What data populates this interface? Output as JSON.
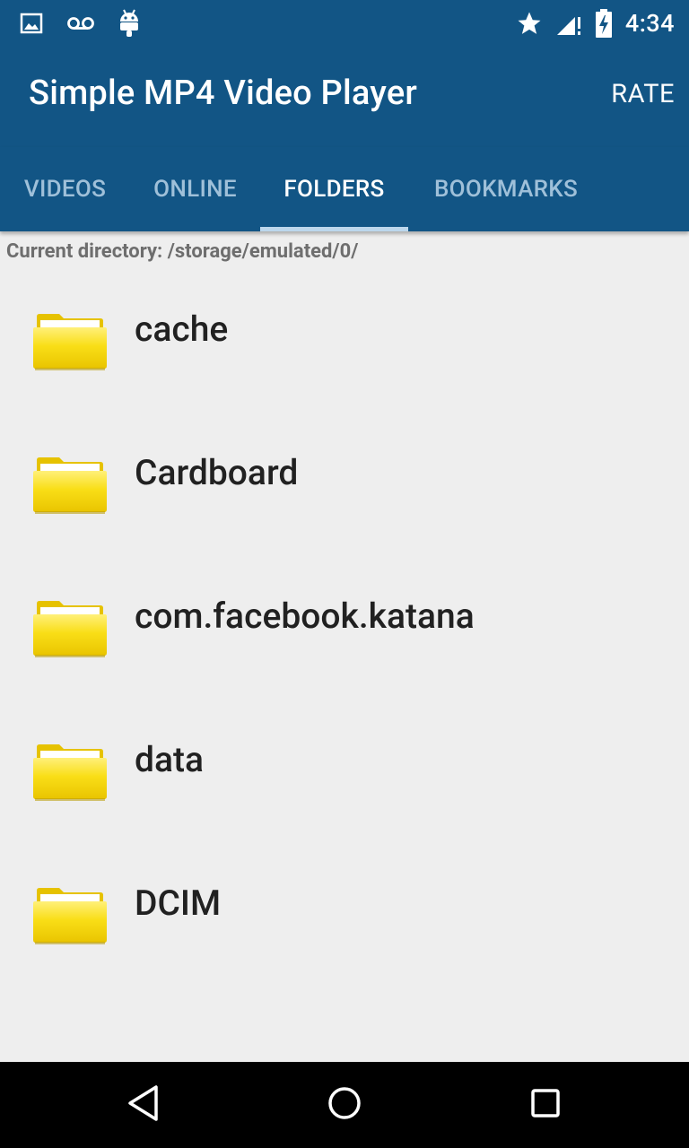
{
  "status_bar": {
    "left_icons": [
      "image-icon",
      "voicemail-icon",
      "android-icon"
    ],
    "right_icons": [
      "star-icon",
      "signal-icon",
      "battery-icon"
    ],
    "time": "4:34"
  },
  "app_bar": {
    "title": "Simple MP4 Video Player",
    "rate_label": "RATE"
  },
  "tabs": [
    {
      "label": "VIDEOS",
      "active": false
    },
    {
      "label": "ONLINE",
      "active": false
    },
    {
      "label": "FOLDERS",
      "active": true
    },
    {
      "label": "BOOKMARKS",
      "active": false
    }
  ],
  "current_directory": "Current directory: /storage/emulated/0/",
  "folders": [
    {
      "name": "cache",
      "icon": "folder-icon"
    },
    {
      "name": "Cardboard",
      "icon": "folder-icon"
    },
    {
      "name": "com.facebook.katana",
      "icon": "folder-icon"
    },
    {
      "name": "data",
      "icon": "folder-icon"
    },
    {
      "name": "DCIM",
      "icon": "folder-icon"
    }
  ],
  "nav_bar": [
    "back-icon",
    "home-icon",
    "recents-icon"
  ],
  "colors": {
    "primary": "#125585",
    "tab_inactive": "#9fc0d9",
    "indicator": "#bcd7ec",
    "background": "#eeeeee",
    "folder": "#f5d000"
  }
}
